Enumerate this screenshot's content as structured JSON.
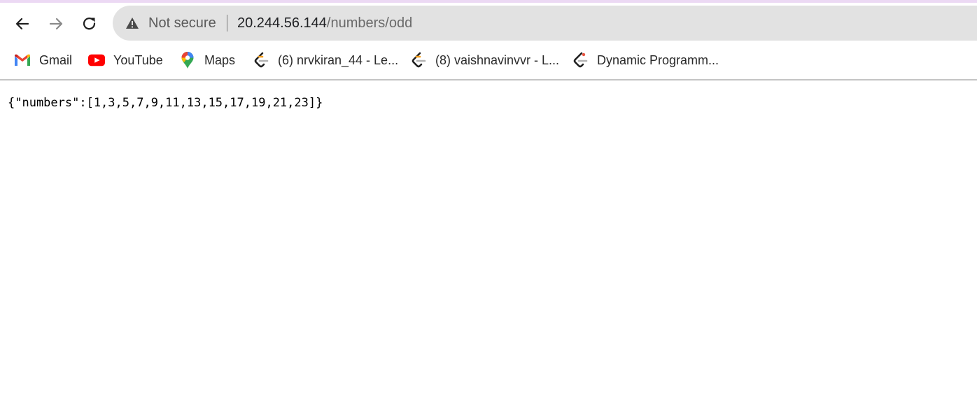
{
  "browser": {
    "accent_color": "#ecd9f4",
    "nav": {
      "back_icon": "arrow-left-icon",
      "forward_icon": "arrow-right-icon",
      "reload_icon": "reload-icon"
    },
    "omnibox": {
      "security_icon": "warning-triangle-icon",
      "security_label": "Not secure",
      "url_host": "20.244.56.144",
      "url_path": "/numbers/odd",
      "background_color": "#e2e2e2"
    },
    "bookmarks": [
      {
        "label": "Gmail",
        "icon": "gmail-icon"
      },
      {
        "label": "YouTube",
        "icon": "youtube-icon"
      },
      {
        "label": "Maps",
        "icon": "maps-pin-icon"
      },
      {
        "label": "(6) nrvkiran_44 - Le...",
        "icon": "leetcode-icon"
      },
      {
        "label": "(8) vaishnavinvvr - L...",
        "icon": "leetcode-icon"
      },
      {
        "label": "Dynamic Programm...",
        "icon": "leetcode-icon"
      }
    ]
  },
  "page": {
    "body_text": "{\"numbers\":[1,3,5,7,9,11,13,15,17,19,21,23]}"
  }
}
